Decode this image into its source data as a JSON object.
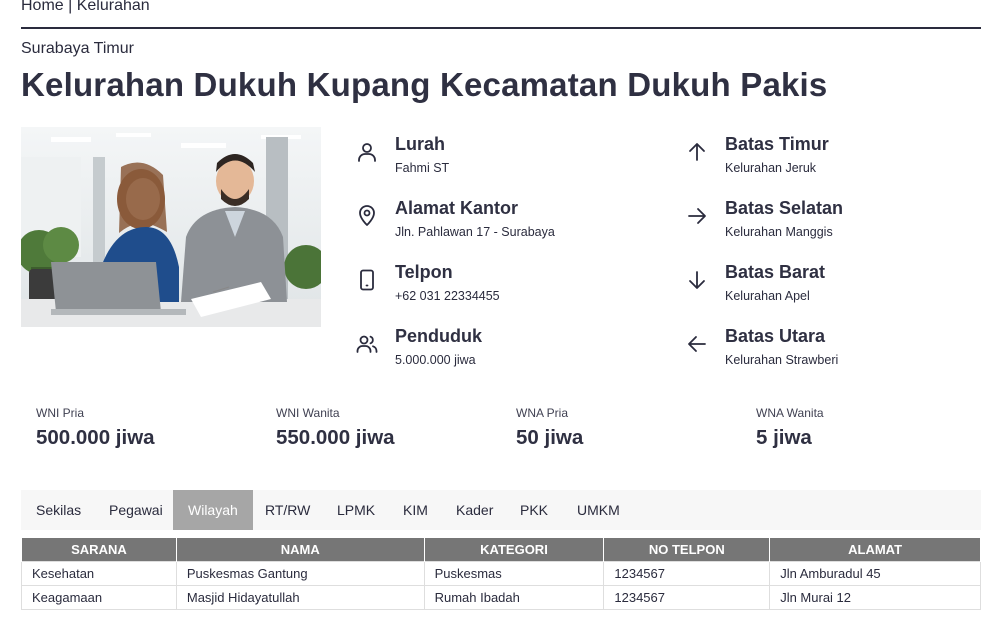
{
  "breadcrumb": {
    "home": "Home",
    "separator": " | ",
    "current": "Kelurahan"
  },
  "header": {
    "subtitle": "Surabaya Timur",
    "title": "Kelurahan Dukuh Kupang Kecamatan Dukuh Pakis"
  },
  "info": {
    "lurah": {
      "title": "Lurah",
      "value": "Fahmi ST",
      "icon": "person-icon"
    },
    "alamat": {
      "title": "Alamat Kantor",
      "value": "Jln. Pahlawan 17 - Surabaya",
      "icon": "location-pin-icon"
    },
    "telpon": {
      "title": "Telpon",
      "value": "+62 031 22334455",
      "icon": "phone-icon"
    },
    "penduduk": {
      "title": "Penduduk",
      "value": "5.000.000 jiwa",
      "icon": "people-icon"
    },
    "timur": {
      "title": "Batas Timur",
      "value": "Kelurahan Jeruk",
      "icon": "arrow-up-icon"
    },
    "selatan": {
      "title": "Batas Selatan",
      "value": "Kelurahan Manggis",
      "icon": "arrow-right-icon"
    },
    "barat": {
      "title": "Batas Barat",
      "value": "Kelurahan Apel",
      "icon": "arrow-down-icon"
    },
    "utara": {
      "title": "Batas Utara",
      "value": "Kelurahan Strawberi",
      "icon": "arrow-left-icon"
    }
  },
  "stats": [
    {
      "label": "WNI Pria",
      "value": "500.000 jiwa"
    },
    {
      "label": "WNI Wanita",
      "value": "550.000 jiwa"
    },
    {
      "label": "WNA Pria",
      "value": "50 jiwa"
    },
    {
      "label": "WNA Wanita",
      "value": "5 jiwa"
    }
  ],
  "tabs": [
    {
      "label": "Sekilas",
      "active": false
    },
    {
      "label": "Pegawai",
      "active": false
    },
    {
      "label": "Wilayah",
      "active": true
    },
    {
      "label": "RT/RW",
      "active": false
    },
    {
      "label": "LPMK",
      "active": false
    },
    {
      "label": "KIM",
      "active": false
    },
    {
      "label": "Kader",
      "active": false
    },
    {
      "label": "PKK",
      "active": false
    },
    {
      "label": "UMKM",
      "active": false
    }
  ],
  "table": {
    "headers": [
      "SARANA",
      "NAMA",
      "KATEGORI",
      "NO TELPON",
      "ALAMAT"
    ],
    "rows": [
      [
        "Kesehatan",
        "Puskesmas Gantung",
        "Puskesmas",
        "1234567",
        "Jln Amburadul 45"
      ],
      [
        "Keagamaan",
        "Masjid Hidayatullah",
        "Rumah Ibadah",
        "1234567",
        "Jln Murai 12"
      ]
    ]
  },
  "colors": {
    "text": "#2a2b3d",
    "tab_active_bg": "#a6a6a6",
    "table_header_bg": "#767676"
  }
}
